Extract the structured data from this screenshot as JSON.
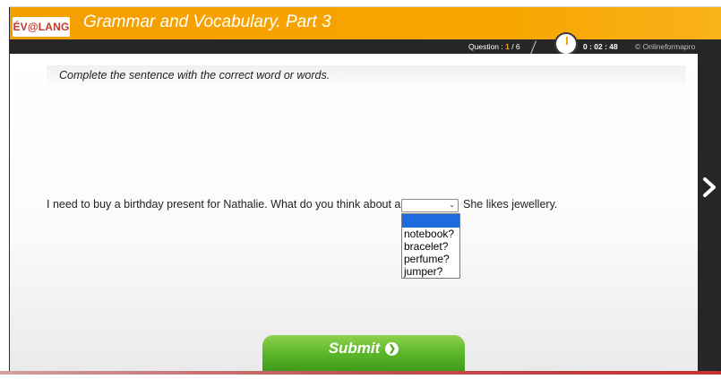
{
  "header": {
    "logo_text": "ÉV@LANG",
    "title": "Grammar and Vocabulary. Part 3"
  },
  "status": {
    "question_prefix": "Question : ",
    "question_current": "1",
    "question_total": " / 6",
    "timer": "0 : 02 : 48",
    "copyright": "© Onlineformapro"
  },
  "main": {
    "instruction": "Complete the sentence with the correct word or words.",
    "sentence_start": "I need to buy a birthday present for Nathalie. What do you think about a",
    "sentence_end": "She likes jewellery.",
    "dropdown": {
      "selected": "",
      "options": [
        "notebook?",
        "bracelet?",
        "perfume?",
        "jumper?"
      ]
    },
    "submit_label": "Submit"
  },
  "icons": {
    "timer": "stopwatch-icon",
    "next": "chevron-right-icon",
    "submit": "arrow-circle-icon"
  },
  "colors": {
    "header_bg": "#f7a600",
    "status_bg": "#262626",
    "submit_green": "#5cb82a",
    "dropdown_highlight": "#1e6be0"
  }
}
